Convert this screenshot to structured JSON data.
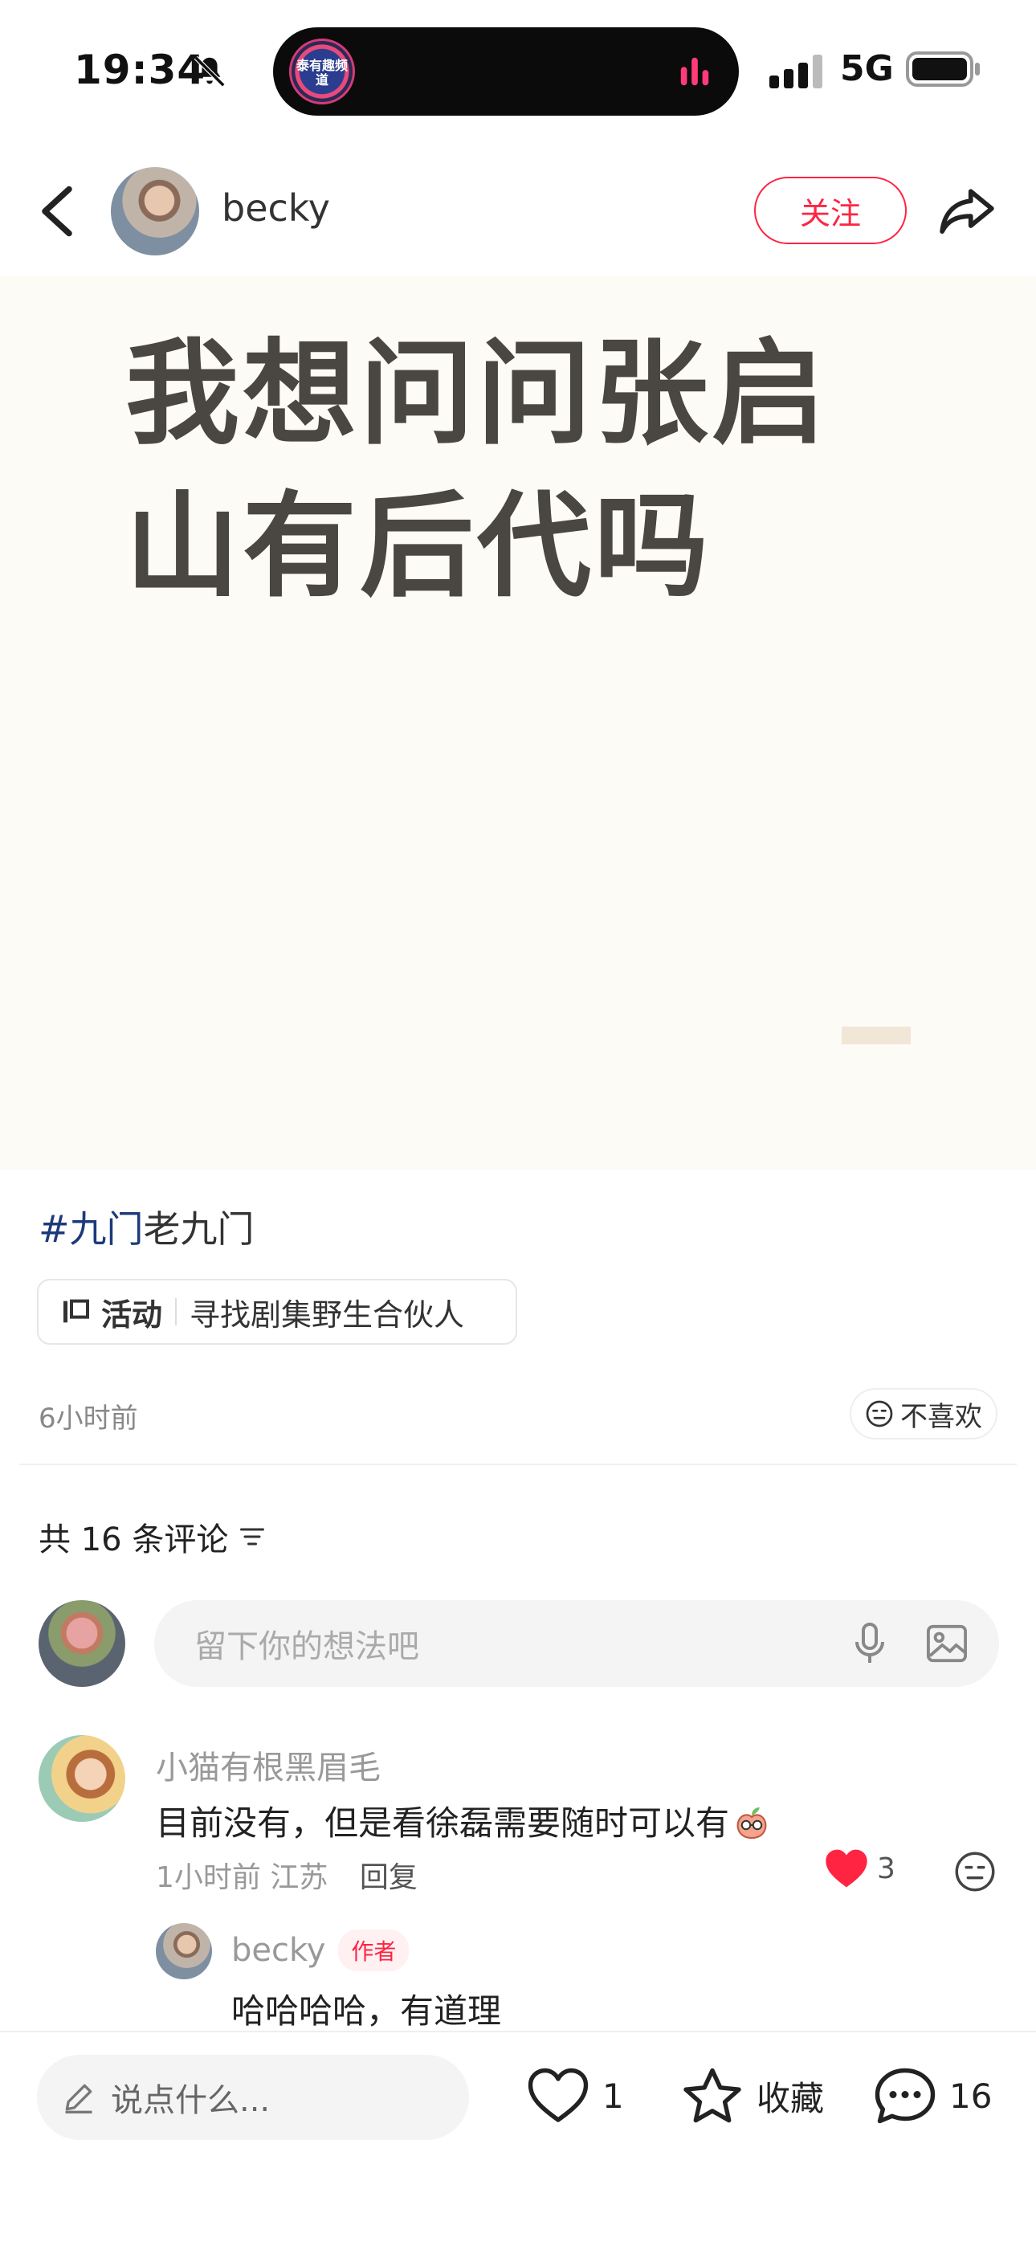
{
  "status_bar": {
    "time": "19:34",
    "network": "5G",
    "island_logo_text": "泰有趣频道"
  },
  "header": {
    "author_name": "becky",
    "follow_label": "关注"
  },
  "post": {
    "image_text": "我想问问张启山有后代吗",
    "hashtag": "#九门",
    "tag_text": "老九门",
    "activity_label": "活动",
    "activity_text": "寻找剧集野生合伙人",
    "time_ago": "6小时前",
    "dislike_label": "不喜欢"
  },
  "comments": {
    "count_label": "共 16 条评论",
    "input_placeholder": "留下你的想法吧",
    "items": [
      {
        "name": "小猫有根黑眉毛",
        "text": "目前没有，但是看徐磊需要随时可以有",
        "time": "1小时前",
        "location": "江苏",
        "reply_label": "回复",
        "likes": "3",
        "replies": [
          {
            "name": "becky",
            "tag": "作者",
            "text": "哈哈哈哈，有道理"
          }
        ]
      }
    ]
  },
  "bottom_bar": {
    "say_placeholder": "说点什么...",
    "like_count": "1",
    "collect_label": "收藏",
    "comment_count": "16"
  },
  "colors": {
    "accent": "#ff2442",
    "hashtag": "#1d3a7a",
    "post_bg": "#fdfbf6"
  }
}
